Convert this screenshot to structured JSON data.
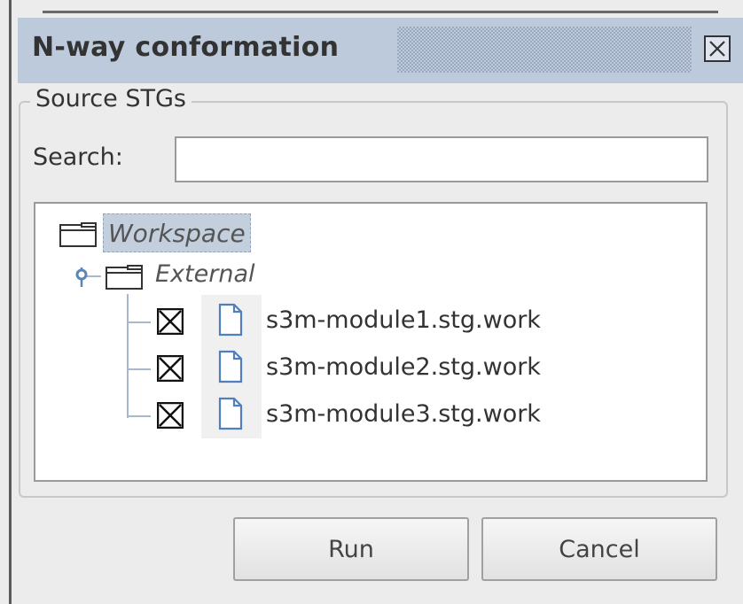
{
  "window": {
    "title": "N-way conformation",
    "close_icon": "close-icon"
  },
  "source_group": {
    "label": "Source STGs"
  },
  "search": {
    "label": "Search:",
    "value": "",
    "placeholder": ""
  },
  "tree": {
    "root": {
      "label": "Workspace",
      "icon": "folder-icon",
      "selected": true
    },
    "folder": {
      "label": "External",
      "icon": "folder-icon",
      "expanded": true
    },
    "files": [
      {
        "label": "s3m-module1.stg.work",
        "checked": true,
        "icon": "file-icon"
      },
      {
        "label": "s3m-module2.stg.work",
        "checked": true,
        "icon": "file-icon"
      },
      {
        "label": "s3m-module3.stg.work",
        "checked": true,
        "icon": "file-icon"
      }
    ]
  },
  "buttons": {
    "run": "Run",
    "cancel": "Cancel"
  },
  "colors": {
    "titlebar": "#bdcadb",
    "selection": "#c3cfdc",
    "tree_lines": "#a8b8cc",
    "background": "#ececec"
  }
}
